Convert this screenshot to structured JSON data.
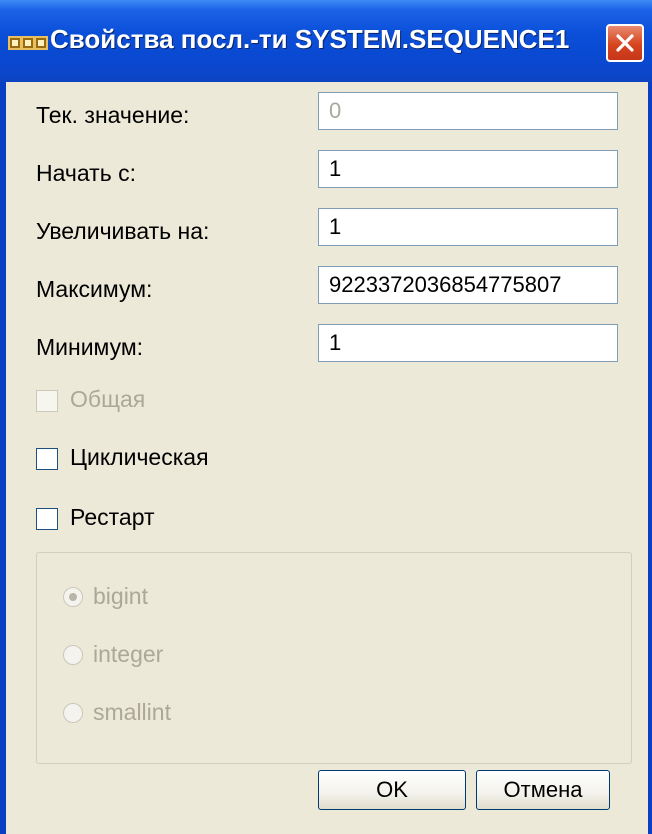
{
  "window": {
    "title": "Свойства посл.-ти SYSTEM.SEQUENCE1",
    "app_icon": "sequence-icon",
    "close_icon": "close-icon",
    "accent_color": "#0a48d0",
    "close_color": "#d6451f"
  },
  "form": {
    "current_value": {
      "label": "Тек. значение:",
      "value": "0",
      "disabled": true
    },
    "start_with": {
      "label": "Начать с:",
      "value": "1"
    },
    "increment_by": {
      "label": "Увеличивать на:",
      "value": "1"
    },
    "maximum": {
      "label": "Максимум:",
      "value": "9223372036854775807"
    },
    "minimum": {
      "label": "Минимум:",
      "value": "1"
    }
  },
  "options": {
    "shared": {
      "label": "Общая",
      "checked": false,
      "disabled": true
    },
    "cyclic": {
      "label": "Циклическая",
      "checked": false
    },
    "restart": {
      "label": "Рестарт",
      "checked": false
    }
  },
  "data_type": {
    "selected": "bigint",
    "disabled": true,
    "options": [
      "bigint",
      "integer",
      "smallint"
    ]
  },
  "buttons": {
    "ok_label": "OK",
    "cancel_label": "Отмена"
  }
}
